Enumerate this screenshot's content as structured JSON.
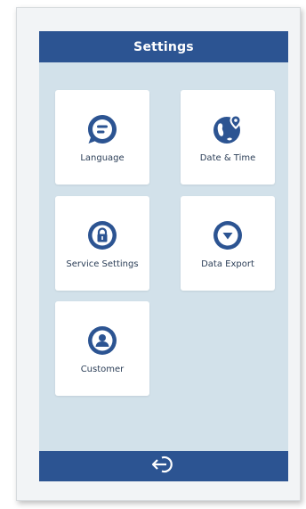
{
  "header": {
    "title": "Settings"
  },
  "tiles": [
    {
      "label": "Language",
      "icon": "chat-bubble-icon"
    },
    {
      "label": "Date & Time",
      "icon": "globe-pin-icon"
    },
    {
      "label": "Service Settings",
      "icon": "lock-icon"
    },
    {
      "label": "Data Export",
      "icon": "download-arrow-icon"
    },
    {
      "label": "Customer",
      "icon": "user-icon"
    }
  ],
  "footer": {
    "back_icon": "back-arrow-icon"
  },
  "colors": {
    "primary": "#2c5492",
    "screen_background": "#d2e1ea",
    "tile_background": "#ffffff",
    "label_text": "#2b3e57"
  }
}
